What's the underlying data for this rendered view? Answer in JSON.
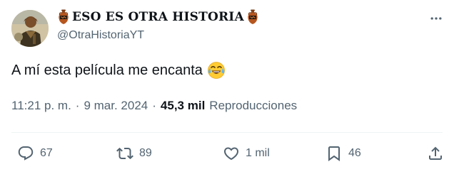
{
  "author": {
    "display_name": "ESO ES OTRA HISTORIA",
    "handle": "@OtraHistoriaYT"
  },
  "tweet": {
    "text": "A mí esta película me encanta",
    "emoji": "face-with-tears-of-joy"
  },
  "meta": {
    "time": "11:21 p. m.",
    "separator": "·",
    "date": "9 mar. 2024",
    "views_count": "45,3 mil",
    "views_label": "Reproducciones"
  },
  "actions": {
    "replies": "67",
    "retweets": "89",
    "likes": "1 mil",
    "bookmarks": "46"
  },
  "colors": {
    "text_primary": "#0f1419",
    "text_secondary": "#536471",
    "divider": "#eff3f4"
  }
}
